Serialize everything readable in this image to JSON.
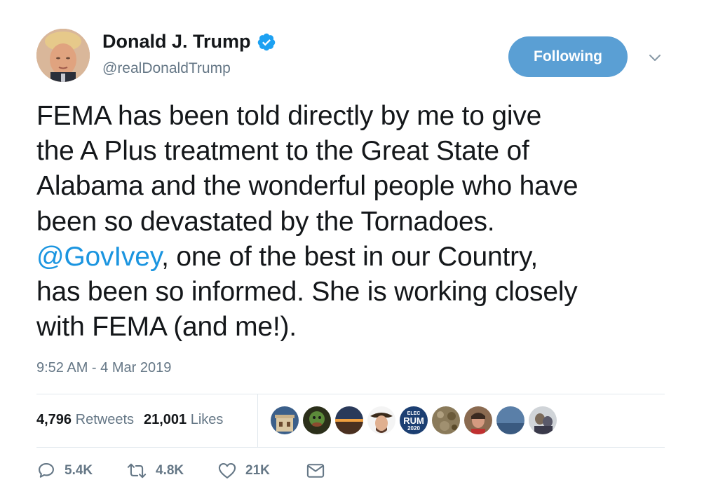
{
  "author": {
    "display_name": "Donald J. Trump",
    "handle": "@realDonaldTrump",
    "verified": true
  },
  "follow_button": {
    "label": "Following"
  },
  "tweet": {
    "lines": [
      "FEMA has been told directly by me to give",
      "the A Plus treatment to the Great State of",
      "Alabama and the wonderful people who have",
      "been so devastated by the Tornadoes."
    ],
    "mention": "@GovIvey",
    "mention_suffix": ", one of the best in our Country,",
    "lines_after": [
      "has been so informed. She is working closely",
      "with FEMA (and me!)."
    ],
    "timestamp": "9:52 AM - 4 Mar 2019"
  },
  "stats": {
    "retweets_count": "4,796",
    "retweets_label": "Retweets",
    "likes_count": "21,001",
    "likes_label": "Likes"
  },
  "liker_avatars": [
    {
      "name": "liker-avatar-1"
    },
    {
      "name": "liker-avatar-2"
    },
    {
      "name": "liker-avatar-3"
    },
    {
      "name": "liker-avatar-4"
    },
    {
      "name": "liker-avatar-5",
      "text_top": "ELEC",
      "text_mid": "RUM",
      "text_bot": "2020"
    },
    {
      "name": "liker-avatar-6"
    },
    {
      "name": "liker-avatar-7"
    },
    {
      "name": "liker-avatar-8"
    },
    {
      "name": "liker-avatar-9"
    }
  ],
  "actions": {
    "reply_count": "5.4K",
    "retweet_count": "4.8K",
    "like_count": "21K"
  },
  "icons": {
    "verified": "verified-badge-icon",
    "caret": "chevron-down-icon",
    "reply": "reply-icon",
    "retweet": "retweet-icon",
    "like": "heart-icon",
    "message": "envelope-icon"
  },
  "colors": {
    "follow_button_bg": "#5a9fd4",
    "mention": "#1b95e0",
    "verified": "#1da1f2",
    "muted": "#657786"
  }
}
